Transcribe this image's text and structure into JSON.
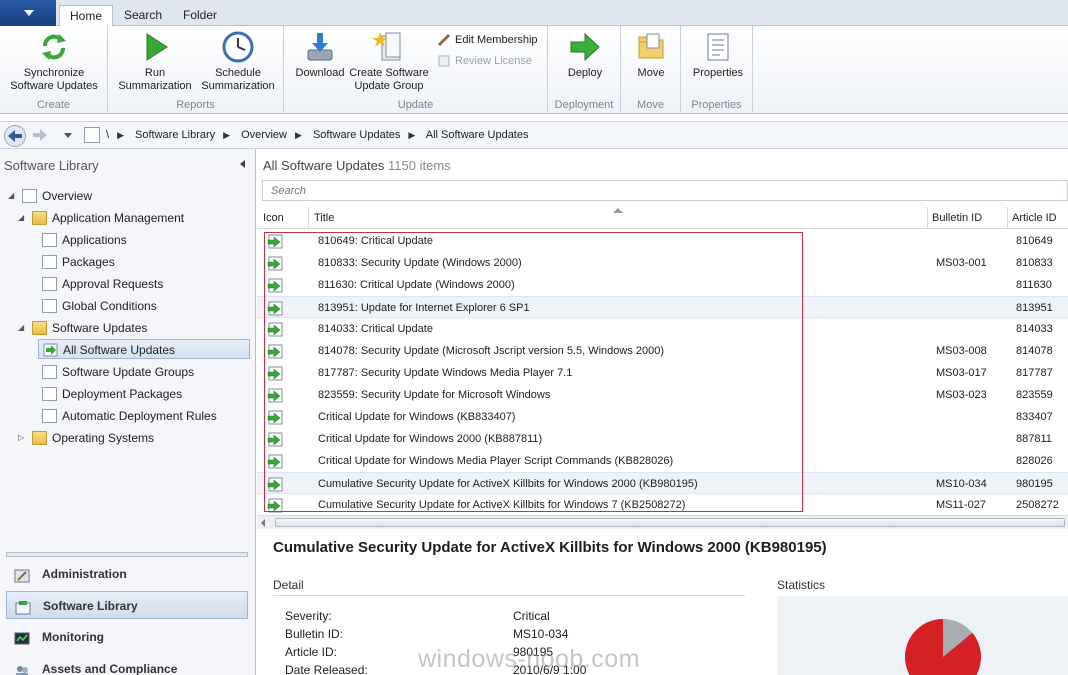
{
  "ribbon_tabs": [
    "Home",
    "Search",
    "Folder"
  ],
  "ribbon": {
    "sync_label_1": "Synchronize",
    "sync_label_2": "Software Updates",
    "run_label_1": "Run",
    "run_label_2": "Summarization",
    "schedule_label_1": "Schedule",
    "schedule_label_2": "Summarization",
    "download_label": "Download",
    "create_label_1": "Create Software",
    "create_label_2": "Update Group",
    "edit_membership": "Edit Membership",
    "review_license": "Review License",
    "deploy_label": "Deploy",
    "move_label": "Move",
    "properties_label": "Properties",
    "groups": [
      "Create",
      "Reports",
      "Update",
      "Deployment",
      "Move",
      "Properties"
    ]
  },
  "breadcrumb": {
    "root": "\\",
    "items": [
      "Software Library",
      "Overview",
      "Software Updates",
      "All Software Updates"
    ]
  },
  "left_pane": {
    "title": "Software Library",
    "tree": {
      "overview": "Overview",
      "app_mgmt": "Application Management",
      "applications": "Applications",
      "packages": "Packages",
      "approval_requests": "Approval Requests",
      "global_conditions": "Global Conditions",
      "software_updates": "Software Updates",
      "all_software_updates": "All Software Updates",
      "update_groups": "Software Update Groups",
      "deployment_packages": "Deployment Packages",
      "adr": "Automatic Deployment Rules",
      "operating_systems": "Operating Systems"
    },
    "workspaces": [
      "Administration",
      "Software Library",
      "Monitoring",
      "Assets and Compliance"
    ]
  },
  "list": {
    "title": "All Software Updates",
    "count": "1150 items",
    "search_placeholder": "Search",
    "columns": [
      "Icon",
      "Title",
      "Bulletin ID",
      "Article ID"
    ],
    "rows": [
      {
        "title": "810649: Critical Update",
        "bulletin": "",
        "article": "810649"
      },
      {
        "title": "810833: Security Update (Windows 2000)",
        "bulletin": "MS03-001",
        "article": "810833"
      },
      {
        "title": "811630: Critical Update (Windows 2000)",
        "bulletin": "",
        "article": "811630"
      },
      {
        "title": "813951: Update for Internet Explorer 6 SP1",
        "bulletin": "",
        "article": "813951"
      },
      {
        "title": "814033: Critical Update",
        "bulletin": "",
        "article": "814033"
      },
      {
        "title": "814078: Security Update (Microsoft Jscript version 5.5, Windows 2000)",
        "bulletin": "MS03-008",
        "article": "814078"
      },
      {
        "title": "817787: Security Update Windows Media Player 7.1",
        "bulletin": "MS03-017",
        "article": "817787"
      },
      {
        "title": "823559: Security Update for Microsoft Windows",
        "bulletin": "MS03-023",
        "article": "823559"
      },
      {
        "title": "Critical Update for Windows (KB833407)",
        "bulletin": "",
        "article": "833407"
      },
      {
        "title": "Critical Update for Windows 2000 (KB887811)",
        "bulletin": "",
        "article": "887811"
      },
      {
        "title": "Critical Update for Windows Media Player Script Commands (KB828026)",
        "bulletin": "",
        "article": "828026"
      },
      {
        "title": "Cumulative Security Update for ActiveX Killbits for Windows 2000 (KB980195)",
        "bulletin": "MS10-034",
        "article": "980195"
      },
      {
        "title": "Cumulative Security Update for ActiveX Killbits for Windows 7 (KB2508272)",
        "bulletin": "MS11-027",
        "article": "2508272"
      }
    ]
  },
  "details": {
    "title": "Cumulative Security Update for ActiveX Killbits for Windows 2000 (KB980195)",
    "detail_heading": "Detail",
    "statistics_heading": "Statistics",
    "fields": [
      {
        "label": "Severity:",
        "value": "Critical"
      },
      {
        "label": "Bulletin ID:",
        "value": "MS10-034"
      },
      {
        "label": "Article ID:",
        "value": "980195"
      },
      {
        "label": "Date Released:",
        "value": "2010/6/9 1:00"
      }
    ],
    "pie_red_fraction": 0.86
  },
  "watermark": "windows-noob.com"
}
